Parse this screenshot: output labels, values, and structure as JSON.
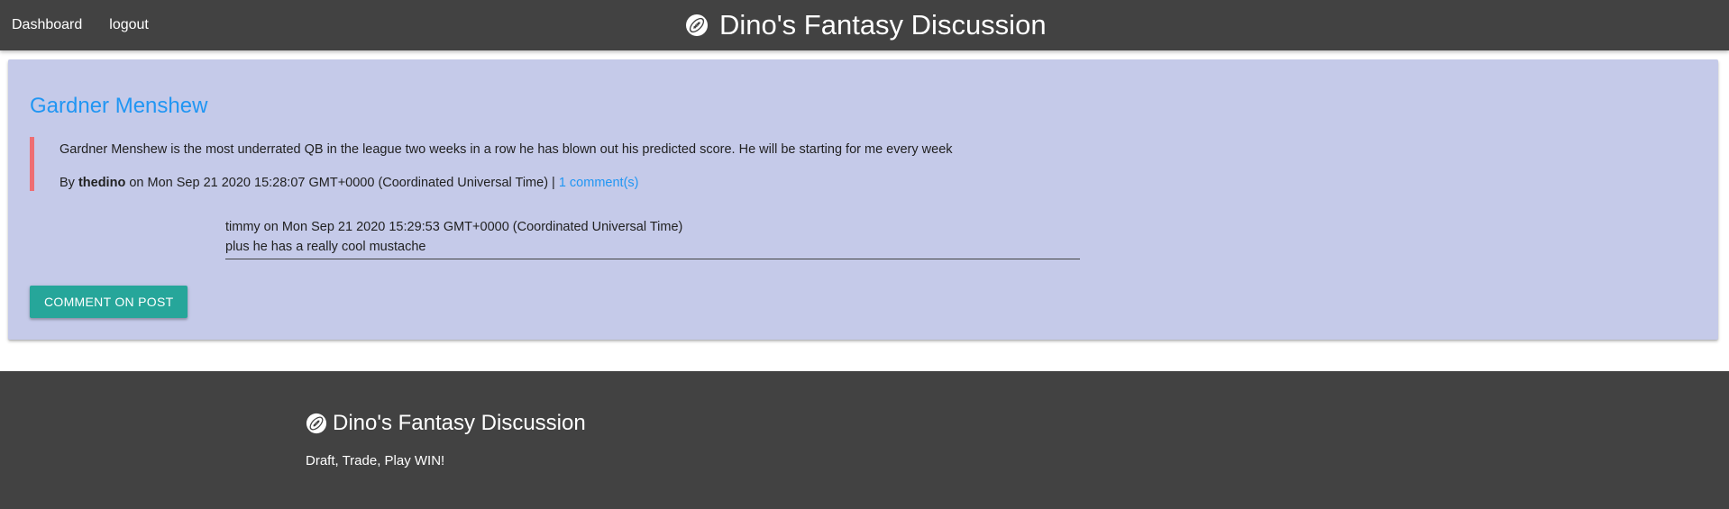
{
  "nav": {
    "links": [
      "Dashboard",
      "logout"
    ],
    "brand": "Dino's Fantasy Discussion",
    "brand_icon": "football-icon"
  },
  "post": {
    "title": "Gardner Menshew",
    "body": "Gardner Menshew is the most underrated QB in the league two weeks in a row he has blown out his predicted score. He will be starting for me every week",
    "by_label": "By",
    "author": "thedino",
    "date_text": "on Mon Sep 21 2020 15:28:07 GMT+0000 (Coordinated Universal Time) |",
    "comments_link": "1 comment(s)"
  },
  "comments": [
    {
      "meta": "timmy on Mon Sep 21 2020 15:29:53 GMT+0000 (Coordinated Universal Time)",
      "text": "plus he has a really cool mustache"
    }
  ],
  "actions": {
    "comment_button": "Comment on post"
  },
  "footer": {
    "brand": "Dino's Fantasy Discussion",
    "tagline": "Draft, Trade, Play WIN!"
  },
  "colors": {
    "navbar": "#424242",
    "card": "#c5cae9",
    "link": "#2196f3",
    "quote_border": "#ee6e73",
    "button": "#26a69a"
  }
}
